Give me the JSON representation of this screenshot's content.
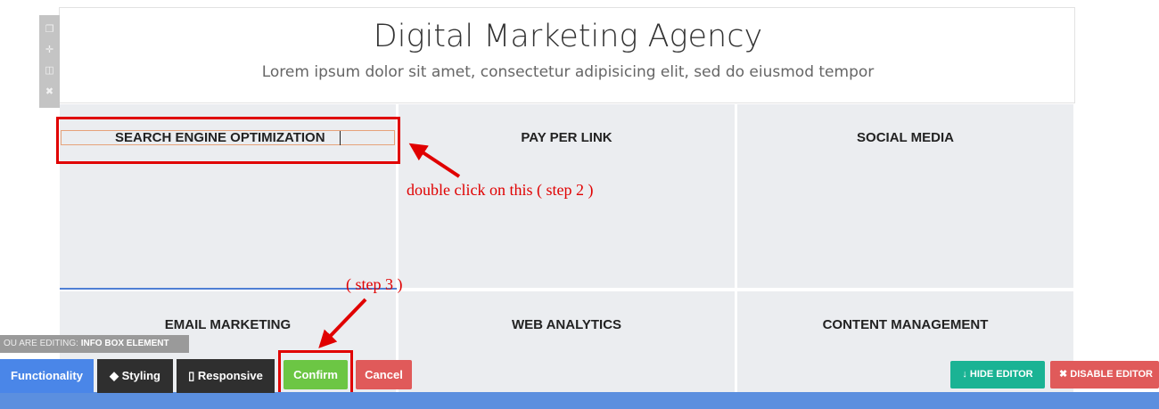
{
  "header": {
    "title": "Digital Marketing Agency",
    "subtitle": "Lorem ipsum dolor sit amet, consectetur adipisicing elit, sed do eiusmod tempor"
  },
  "side_toolbar": {
    "icons": [
      "clone-icon",
      "move-icon",
      "columns-icon",
      "close-icon"
    ]
  },
  "grid": {
    "cells": [
      {
        "title": "SEARCH ENGINE OPTIMIZATION"
      },
      {
        "title": "PAY PER LINK"
      },
      {
        "title": "SOCIAL MEDIA"
      },
      {
        "title": "EMAIL MARKETING"
      },
      {
        "title": "WEB ANALYTICS"
      },
      {
        "title": "CONTENT MANAGEMENT"
      }
    ]
  },
  "annotations": {
    "step2": "double click on this ( step 2 )",
    "step3": "( step 3 )",
    "color": "#e00000"
  },
  "editing": {
    "prefix": "OU ARE EDITING:",
    "element": "INFO BOX ELEMENT"
  },
  "toolbar": {
    "tabs": [
      {
        "label": "Functionality",
        "active": true
      },
      {
        "label": "Styling",
        "icon": "drop-icon"
      },
      {
        "label": "Responsive",
        "icon": "mobile-icon"
      }
    ],
    "confirm_label": "Confirm",
    "cancel_label": "Cancel",
    "hide_editor_label": "HIDE EDITOR",
    "disable_editor_label": "DISABLE EDITOR"
  },
  "colors": {
    "accent_blue": "#5b8fdf",
    "confirm_green": "#6cc644",
    "cancel_red": "#e05a5a",
    "hide_teal": "#1ab394"
  }
}
